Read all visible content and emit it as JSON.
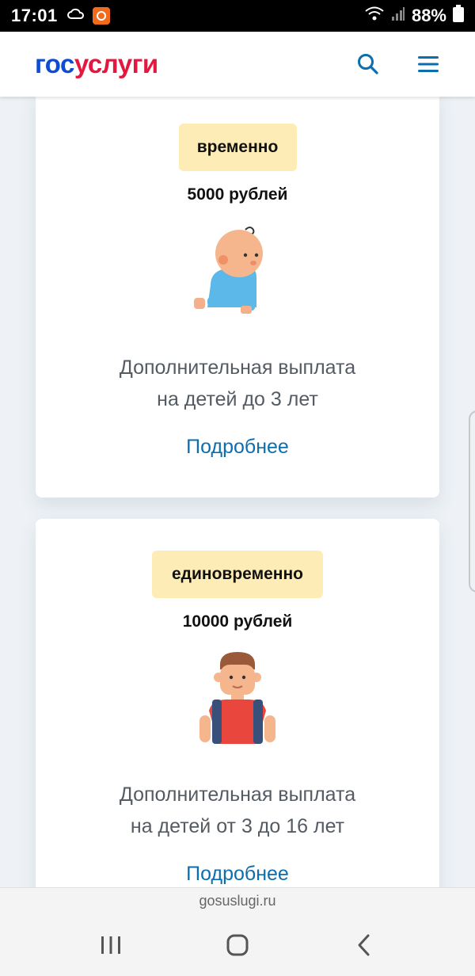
{
  "status_bar": {
    "time": "17:01",
    "battery": "88%"
  },
  "header": {
    "logo_part1": "гос",
    "logo_part2": "услуги"
  },
  "cards": [
    {
      "badge": "временно",
      "amount": "5000 рублей",
      "illustration": "crawling-baby",
      "desc_line1": "Дополнительная выплата",
      "desc_line2": "на детей до 3 лет",
      "more_label": "Подробнее"
    },
    {
      "badge": "единовременно",
      "amount": "10000 рублей",
      "illustration": "schoolboy-with-backpack",
      "desc_line1": "Дополнительная выплата",
      "desc_line2": "на детей от 3 до 16 лет",
      "more_label": "Подробнее"
    }
  ],
  "browser": {
    "url": "gosuslugi.ru"
  },
  "colors": {
    "brand_blue": "#0d4cd3",
    "brand_red": "#e4173f",
    "link_blue": "#0d6eaf",
    "badge_yellow": "#fdecb5"
  }
}
